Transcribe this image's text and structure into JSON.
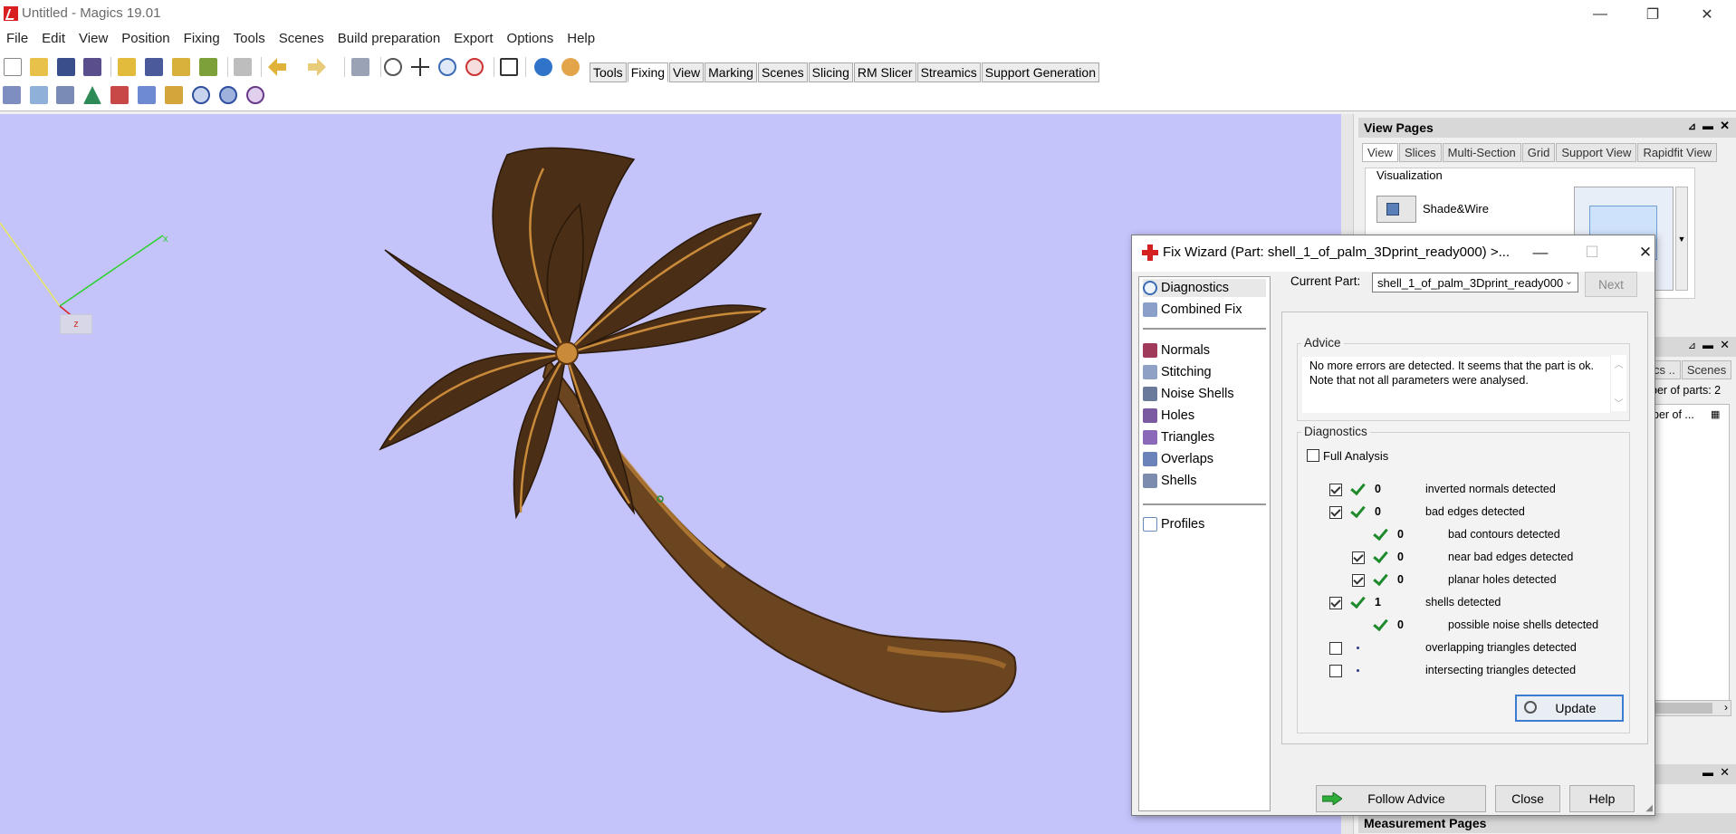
{
  "window": {
    "title": "Untitled - Magics 19.01",
    "minimize_glyph": "—",
    "restore_glyph": "❐",
    "close_glyph": "✕"
  },
  "menu": [
    "File",
    "Edit",
    "View",
    "Position",
    "Fixing",
    "Tools",
    "Scenes",
    "Build preparation",
    "Export",
    "Options",
    "Help"
  ],
  "ribbon_tabs": [
    {
      "label": "Tools",
      "active": false
    },
    {
      "label": "Fixing",
      "active": true
    },
    {
      "label": "View",
      "active": false
    },
    {
      "label": "Marking",
      "active": false
    },
    {
      "label": "Scenes",
      "active": false
    },
    {
      "label": "Slicing",
      "active": false
    },
    {
      "label": "RM Slicer",
      "active": false
    },
    {
      "label": "Streamics",
      "active": false
    },
    {
      "label": "Support Generation",
      "active": false
    }
  ],
  "viewport": {
    "background": "#c4c4fb",
    "axis_x_label": "x",
    "axis_z_label": "z"
  },
  "view_pages": {
    "title": "View Pages",
    "tabs": [
      "View",
      "Slices",
      "Multi-Section",
      "Grid",
      "Support View",
      "Rapidfit View"
    ],
    "active_tab": "View",
    "group_label": "Visualization",
    "mode_label": "Shade&Wire"
  },
  "scene_panel": {
    "tabs": [
      "cs ..",
      "Scenes"
    ],
    "parts_count_text": "ber of parts: 2",
    "column_text": "ber of ..."
  },
  "measurement_pages": {
    "title": "Measurement Pages"
  },
  "fix_wizard": {
    "title": "Fix Wizard (Part: shell_1_of_palm_3Dprint_ready000) >...",
    "nav_top": [
      {
        "label": "Diagnostics",
        "icon": "magnifier-icon",
        "active": true
      },
      {
        "label": "Combined Fix",
        "icon": "combined-fix-icon",
        "active": false
      }
    ],
    "nav_mid": [
      {
        "label": "Normals",
        "icon": "normals-icon"
      },
      {
        "label": "Stitching",
        "icon": "stitching-icon"
      },
      {
        "label": "Noise Shells",
        "icon": "noise-shells-icon"
      },
      {
        "label": "Holes",
        "icon": "holes-icon"
      },
      {
        "label": "Triangles",
        "icon": "triangles-icon"
      },
      {
        "label": "Overlaps",
        "icon": "overlaps-icon"
      },
      {
        "label": "Shells",
        "icon": "shells-icon"
      }
    ],
    "nav_bottom": [
      {
        "label": "Profiles",
        "icon": "profiles-icon"
      }
    ],
    "current_part_label": "Current Part:",
    "current_part_value": "shell_1_of_palm_3Dprint_ready000",
    "next_label": "Next",
    "advice_title": "Advice",
    "advice_text": "No more errors are detected. It seems that the part is ok. Note that not all parameters were analysed.",
    "diagnostics_title": "Diagnostics",
    "full_analysis_label": "Full Analysis",
    "full_analysis_checked": false,
    "rows": [
      {
        "checkbox": true,
        "checked": true,
        "status": "ok",
        "value": "0",
        "label": "inverted normals detected",
        "indent": 0
      },
      {
        "checkbox": true,
        "checked": true,
        "status": "ok",
        "value": "0",
        "label": "bad edges detected",
        "indent": 0
      },
      {
        "checkbox": false,
        "checked": false,
        "status": "ok",
        "value": "0",
        "label": "bad contours detected",
        "indent": 1
      },
      {
        "checkbox": true,
        "checked": true,
        "status": "ok",
        "value": "0",
        "label": "near bad edges detected",
        "indent": 1
      },
      {
        "checkbox": true,
        "checked": true,
        "status": "ok",
        "value": "0",
        "label": "planar holes detected",
        "indent": 1
      },
      {
        "checkbox": true,
        "checked": true,
        "status": "ok",
        "value": "1",
        "label": "shells detected",
        "indent": 0
      },
      {
        "checkbox": false,
        "checked": false,
        "status": "ok",
        "value": "0",
        "label": "possible noise shells detected",
        "indent": 1
      },
      {
        "checkbox": true,
        "checked": false,
        "status": "unknown",
        "value": "",
        "label": "overlapping triangles detected",
        "indent": 0
      },
      {
        "checkbox": true,
        "checked": false,
        "status": "unknown",
        "value": "",
        "label": "intersecting triangles detected",
        "indent": 0
      }
    ],
    "update_label": "Update",
    "follow_advice_label": "Follow Advice",
    "close_label": "Close",
    "help_label": "Help"
  }
}
